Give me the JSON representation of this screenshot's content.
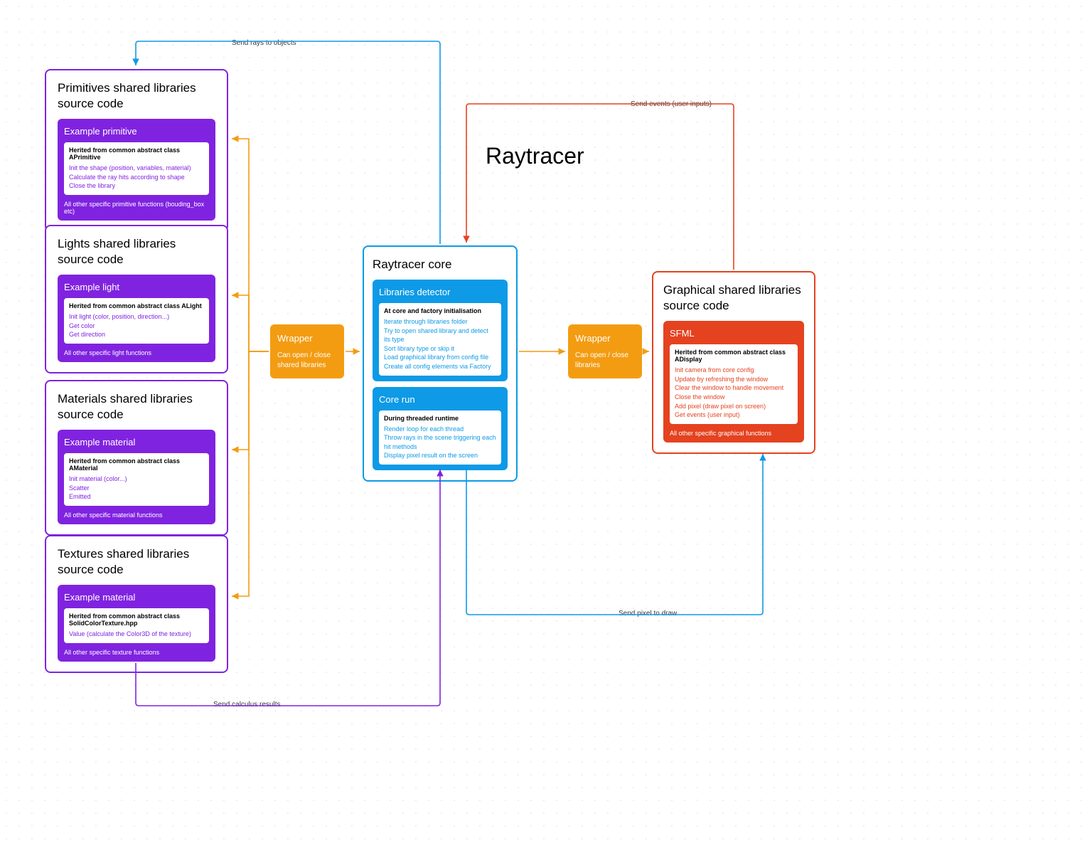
{
  "title": "Raytracer",
  "purple_boxes": [
    {
      "title": "Primitives shared libraries source code",
      "card_title": "Example primitive",
      "header": "Herited from common abstract class APrimitive",
      "lines": [
        "Init the shape (position, variables, material)",
        "Calculate the ray hits according to shape",
        "Close the library"
      ],
      "footer": "All other specific primitive functions (bouding_box etc)"
    },
    {
      "title": "Lights shared libraries source code",
      "card_title": "Example light",
      "header": "Herited from common abstract class ALight",
      "lines": [
        "Init light (color, position, direction...)",
        "Get color",
        "Get direction"
      ],
      "footer": "All other specific light functions"
    },
    {
      "title": "Materials shared libraries source code",
      "card_title": "Example material",
      "header": "Herited from common abstract class AMaterial",
      "lines": [
        "Init material (color...)",
        "Scatter",
        "Emitted"
      ],
      "footer": "All other specific material functions"
    },
    {
      "title": "Textures shared libraries source code",
      "card_title": "Example material",
      "header": "Herited from common abstract class SolidColorTexture.hpp",
      "lines": [
        "Value (calculate the Color3D of the texture)"
      ],
      "footer": "All other specific texture functions"
    }
  ],
  "wrappers": [
    {
      "title": "Wrapper",
      "desc": "Can open / close shared libraries"
    },
    {
      "title": "Wrapper",
      "desc": "Can open / close libraries"
    }
  ],
  "core": {
    "title": "Raytracer core",
    "cards": [
      {
        "title": "Libraries detector",
        "header": "At core and factory initialisation",
        "lines": [
          "Iterate through libraries folder",
          "Try to open shared library and detect its type",
          "Sort library type or skip it",
          "Load graphical library from config file",
          "Create all config elements via Factory"
        ]
      },
      {
        "title": "Core run",
        "header": "During threaded runtime",
        "lines": [
          "Render loop for each thread",
          "Throw rays in the scene triggering each hit methods",
          "Display pixel result on the screen"
        ]
      }
    ]
  },
  "gfx": {
    "title": "Graphical shared libraries source code",
    "card_title": "SFML",
    "header": "Herited from common abstract class ADisplay",
    "lines": [
      "Init camera from core config",
      "Update by refreshing the window",
      "Clear the window to handle movement",
      "Close the window",
      "Add pixel (draw pixel on screen)",
      "Get events (user input)"
    ],
    "footer": "All other specific graphical functions"
  },
  "edge_labels": {
    "top": "Send rays to objects",
    "bottom_left": "Send calculus results",
    "top_right": "Send events (user inputs)",
    "bottom_right": "Send pixel to draw"
  }
}
